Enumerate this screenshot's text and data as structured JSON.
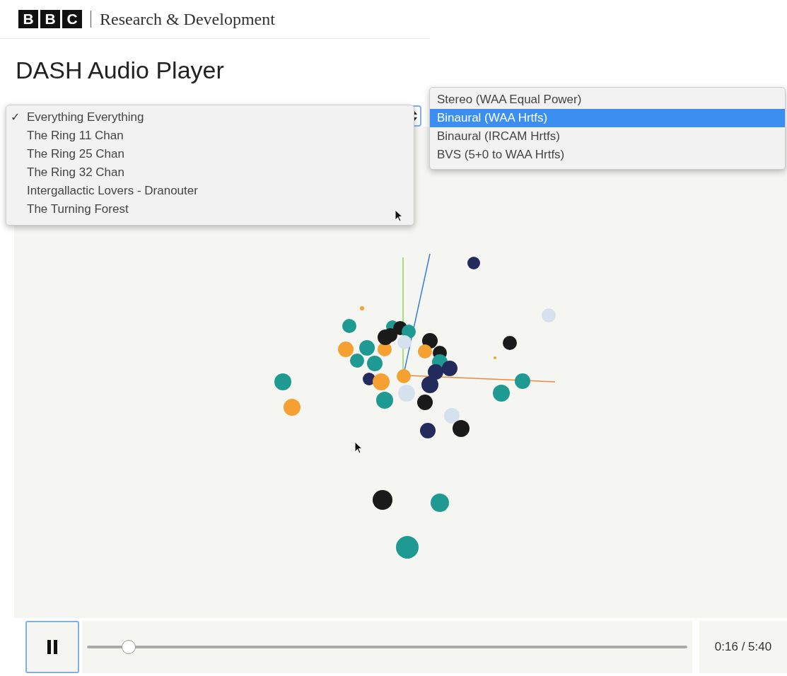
{
  "header": {
    "logo_letters": [
      "B",
      "B",
      "C"
    ],
    "site": "Research & Development"
  },
  "title": "DASH Audio Player",
  "track_menu": {
    "check_mark": "✓",
    "items": [
      {
        "label": "Everything Everything",
        "selected": true
      },
      {
        "label": "The Ring 11 Chan",
        "selected": false
      },
      {
        "label": "The Ring 25 Chan",
        "selected": false
      },
      {
        "label": "The Ring 32 Chan",
        "selected": false
      },
      {
        "label": "Intergallactic Lovers - Dranouter",
        "selected": false
      },
      {
        "label": "The Turning Forest",
        "selected": false
      }
    ]
  },
  "render_menu": {
    "items": [
      {
        "label": "Stereo (WAA Equal Power)",
        "selected": false
      },
      {
        "label": "Binaural (WAA Hrtfs)",
        "selected": true
      },
      {
        "label": "Binaural (IRCAM Hrtfs)",
        "selected": false
      },
      {
        "label": "BVS (5+0 to WAA Hrtfs)",
        "selected": false
      }
    ]
  },
  "controls": {
    "playing": true,
    "level": 0.07,
    "time": "0:16 / 5:40"
  }
}
